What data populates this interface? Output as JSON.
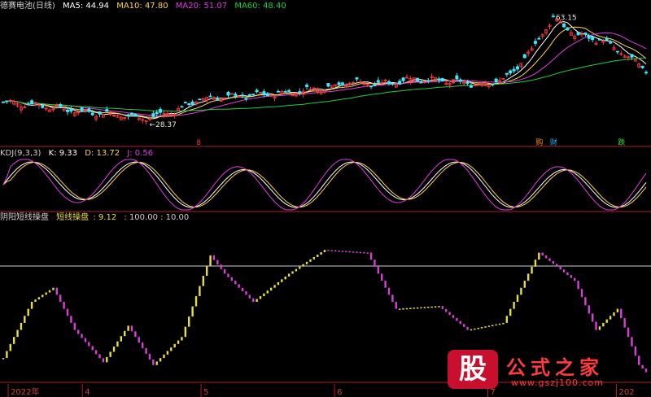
{
  "panel_main": {
    "title": "德赛电池(日线)",
    "ma": [
      {
        "label": "MA5: 44.94",
        "color": "#ffffff"
      },
      {
        "label": "MA10: 47.80",
        "color": "#ffd24a"
      },
      {
        "label": "MA20: 51.07",
        "color": "#e13be1"
      },
      {
        "label": "MA60: 48.40",
        "color": "#1fcf3f"
      }
    ],
    "max_label": "63.15",
    "min_label": "28.37",
    "marks": [
      {
        "text": "8",
        "color": "#ff3333",
        "x_index": 55
      },
      {
        "text": "购",
        "color": "#ff8c00",
        "x_index": 150
      },
      {
        "text": "财",
        "color": "#22b5ff",
        "x_index": 154
      },
      {
        "text": "跌",
        "color": "#2bdc2b",
        "x_index": 173
      }
    ]
  },
  "panel_kdj": {
    "title": "KDJ(9,3,3)",
    "k_label": "K: 9.33",
    "d_label": "D: 13.72",
    "j_label": "J: 0.56",
    "k_color": "#ffffff",
    "d_color": "#ffd24a",
    "j_color": "#e13be1"
  },
  "panel_ind": {
    "title": "阴阳短线操盘",
    "name_label": "短线操盘",
    "value_label": ": 9.12",
    "levels_label": ": 100.00 : 10.00",
    "up_color": "#e8dd45",
    "down_color": "#d83fd8"
  },
  "axis": {
    "labels": [
      {
        "text": "2022年",
        "x_index": 1
      },
      {
        "text": "4",
        "x_index": 16
      },
      {
        "text": "5",
        "x_index": 40
      },
      {
        "text": "6",
        "x_index": 67
      },
      {
        "text": "7",
        "x_index": 98
      },
      {
        "text": "202",
        "x_index": 124
      }
    ]
  },
  "watermark": {
    "logo": "股",
    "title": "公式之家",
    "url": "www.gszj100.com"
  },
  "chart_data": {
    "type": "candlestick",
    "count": 181,
    "price": {
      "ylim": [
        20,
        65
      ],
      "max": 63.15,
      "min": 28.37
    },
    "indicator": {
      "ylim": [
        0,
        110
      ],
      "levels": [
        100,
        10
      ]
    }
  }
}
